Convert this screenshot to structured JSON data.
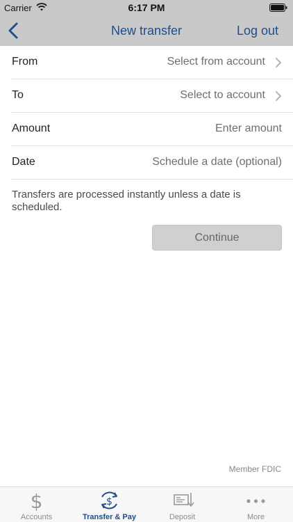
{
  "status_bar": {
    "carrier": "Carrier",
    "time": "6:17 PM"
  },
  "nav": {
    "title": "New transfer",
    "logout_label": "Log out",
    "back_icon": "chevron-left-icon"
  },
  "form": {
    "rows": [
      {
        "label": "From",
        "value": "Select from account",
        "chevron": true
      },
      {
        "label": "To",
        "value": "Select to account",
        "chevron": true
      },
      {
        "label": "Amount",
        "value": "Enter amount",
        "chevron": false
      },
      {
        "label": "Date",
        "value": "Schedule a date (optional)",
        "chevron": false
      }
    ],
    "note": "Transfers are processed instantly unless a date is scheduled.",
    "continue_label": "Continue"
  },
  "footer": {
    "fdic": "Member FDIC"
  },
  "tabs": [
    {
      "label": "Accounts",
      "icon": "dollar-icon",
      "active": false
    },
    {
      "label": "Transfer & Pay",
      "icon": "transfer-dollar-icon",
      "active": true
    },
    {
      "label": "Deposit",
      "icon": "check-deposit-icon",
      "active": false
    },
    {
      "label": "More",
      "icon": "ellipsis-icon",
      "active": false
    }
  ],
  "colors": {
    "accent": "#1f4d8a",
    "nav_bg": "#c9c9c9",
    "button_disabled": "#d0d0d0"
  }
}
